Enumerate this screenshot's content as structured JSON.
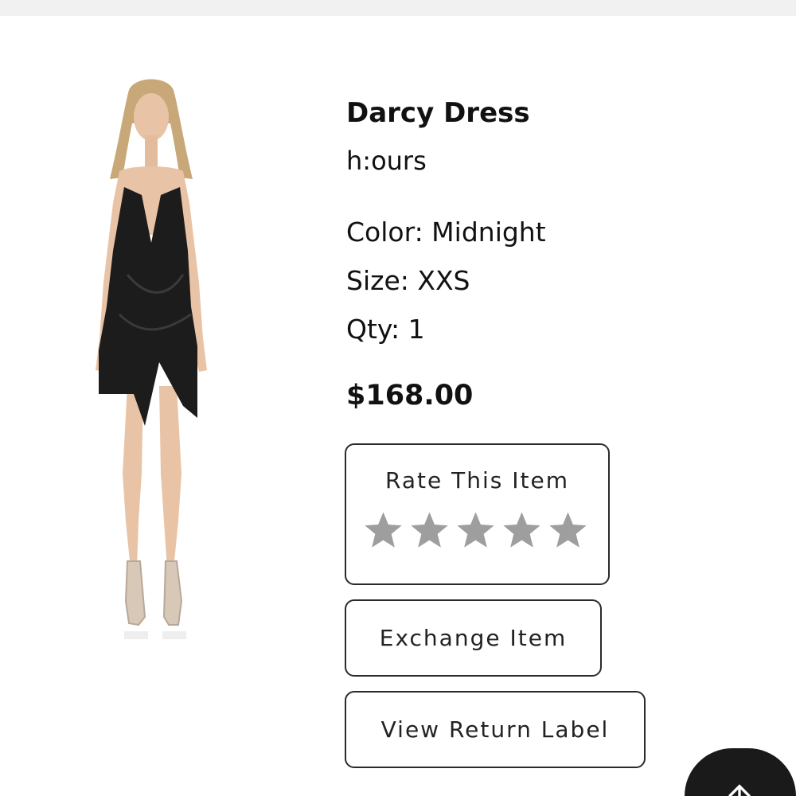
{
  "product": {
    "name": "Darcy Dress",
    "brand": "h:ours",
    "color": "Color: Midnight",
    "size": "Size: XXS",
    "qty": "Qty: 1",
    "price": "$168.00"
  },
  "actions": {
    "rate_label": "Rate This Item",
    "rating_max": 5,
    "rating_value": 0,
    "exchange_label": "Exchange Item",
    "return_label": "View Return Label"
  },
  "colors": {
    "star": "#9e9e9e",
    "border": "#2a2a2a",
    "scroll_button": "#1a1a1a"
  },
  "icons": {
    "scroll": "arrow-up-icon",
    "rating": "star-icon"
  }
}
